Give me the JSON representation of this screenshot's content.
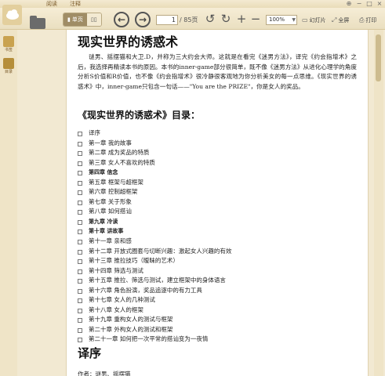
{
  "menu": {
    "tabs": [
      "阅读",
      "注释"
    ]
  },
  "window": {
    "pin": "⊕",
    "minimize": "−",
    "maximize": "□",
    "close": "×"
  },
  "toolbar": {
    "view_single": "单页",
    "view_double": "",
    "page_current": "1",
    "page_total": "/ 85页",
    "zoom": "100%",
    "slideshow_label": "幻灯片",
    "fullscreen_label": "全屏",
    "print_label": "打印"
  },
  "leftbar": {
    "bookmarks_label": "书签",
    "toc_label": "目录"
  },
  "doc": {
    "title": "现实世界的诱惑术",
    "intro": "谜男、摇摆猫和大卫.D，并称为三大约会大师。这就是在看完《迷男方法》，译完《约会指增术》之后，我选择再精读本书的原因。本书的inner-game部分很简单，既不像《迷男方法》从进化心理学的角度分析S价值和R价值，也不像《约会指增术》很冷静很客观地为你分析美女的每一点思维。《现实世界的诱惑术》中，inner-game只包含一句话——\"You are the PRIZE\"，你是女人的奖品。",
    "toc_heading": "《现实世界的诱惑术》目录：",
    "toc": [
      {
        "text": "译序",
        "bold": false
      },
      {
        "text": "第一章 我的故事",
        "bold": false
      },
      {
        "text": "第二章 成为奖品的特质",
        "bold": false
      },
      {
        "text": "第三章 女人不喜欢的特质",
        "bold": false
      },
      {
        "text": "第四章 信念",
        "bold": true
      },
      {
        "text": "第五章 框架与超框架",
        "bold": false
      },
      {
        "text": "第六章 控制超框架",
        "bold": false
      },
      {
        "text": "第七章 关于形象",
        "bold": false
      },
      {
        "text": "第八章 如何搭讪",
        "bold": false
      },
      {
        "text": "第九章 冷读",
        "bold": true
      },
      {
        "text": "第十章 讲故事",
        "bold": true
      },
      {
        "text": "第十一章 亲和感",
        "bold": false
      },
      {
        "text": "第十二章 开放式圈套与切断兴趣：激起女人兴趣的有效",
        "bold": false
      },
      {
        "text": "第十三章 推拉技巧（暧昧的艺术）",
        "bold": false
      },
      {
        "text": "第十四章 筛选与测试",
        "bold": false
      },
      {
        "text": "第十五章 推拉、筛选与测试，建立框架中的身体语言",
        "bold": false
      },
      {
        "text": "第十六章 角色扮演，奖品追逐中的有力工具",
        "bold": false
      },
      {
        "text": "第十七章 女人的几种测试",
        "bold": false
      },
      {
        "text": "第十八章 女人的框架",
        "bold": false
      },
      {
        "text": "第十九章 重构女人的测试与框架",
        "bold": false
      },
      {
        "text": "第二十章 外构女人的测试和框架",
        "bold": false
      },
      {
        "text": "第二十一章 如何把一次平常的搭讪变为一夜情",
        "bold": false
      }
    ],
    "preface_heading": "译序",
    "cut_line": "作者：谜男、摇摆猫"
  },
  "colors": {
    "bg": "#efe4c7",
    "page": "#ffffff",
    "accent": "#a08d66"
  }
}
